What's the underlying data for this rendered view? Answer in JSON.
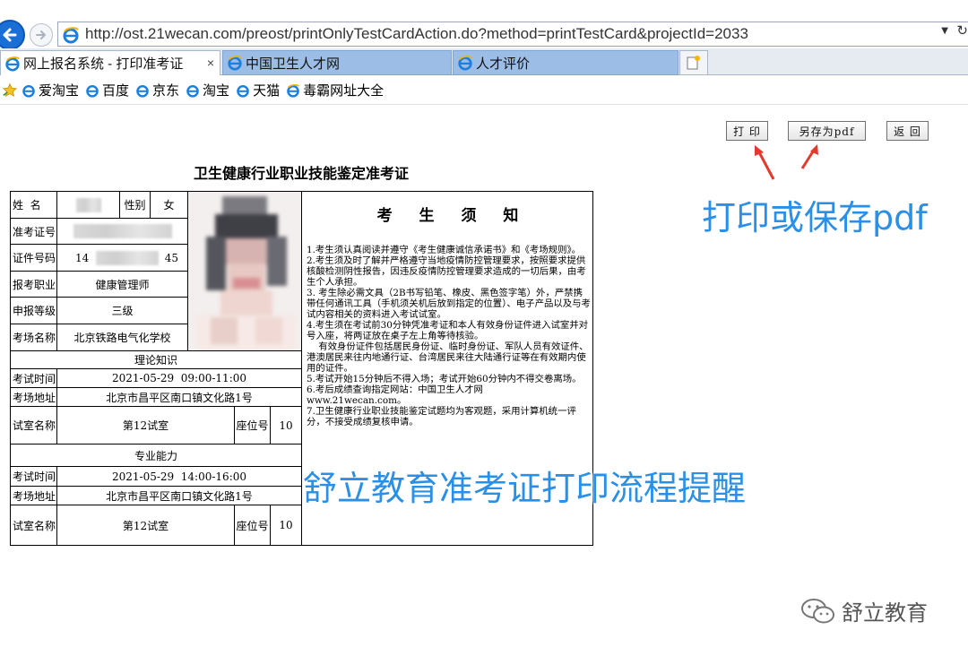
{
  "browser": {
    "url": "http://ost.21wecan.com/preost/printOnlyTestCardAction.do?method=printTestCard&projectId=2033",
    "tabs": [
      {
        "label": "网上报名系统 - 打印准考证",
        "close": "×"
      },
      {
        "label": "中国卫生人才网"
      },
      {
        "label": "人才评价"
      }
    ],
    "favorites": [
      "爱淘宝",
      "百度",
      "京东",
      "淘宝",
      "天猫",
      "毒霸网址大全"
    ]
  },
  "toolbar": {
    "print_label": "打 印",
    "savepdf_label": "另存为pdf",
    "back_label": "返 回"
  },
  "ticket": {
    "title": "卫生健康行业职业技能鉴定准考证",
    "labels": {
      "name": "姓  名",
      "gender": "性别",
      "exam_no": "准考证号",
      "id_no": "证件号码",
      "job": "报考职业",
      "level": "申报等级",
      "site": "考场名称",
      "theory": "理论知识",
      "time": "考试时间",
      "address": "考场地址",
      "room": "试室名称",
      "seat": "座位号",
      "skill": "专业能力"
    },
    "values": {
      "gender": "女",
      "id_prefix": "14",
      "id_suffix": "45",
      "job": "健康管理师",
      "level": "三级",
      "site": "北京铁路电气化学校",
      "theory_time": "2021-05-29  09:00-11:00",
      "theory_address": "北京市昌平区南口镇文化路1号",
      "theory_room": "第12试室",
      "theory_seat": "10",
      "skill_time": "2021-05-29  14:00-16:00",
      "skill_address": "北京市昌平区南口镇文化路1号",
      "skill_room": "第12试室",
      "skill_seat": "10"
    },
    "notice_title": "考 生 须 知",
    "notice": [
      "1.考生须认真阅读并遵守《考生健康诚信承诺书》和《考场规则》。",
      "2.考生须及时了解并严格遵守当地疫情防控管理要求，按照要求提供核酸检测阴性报告，因违反疫情防控管理要求造成的一切后果，由考生个人承担。",
      "3. 考生除必需文具（2B书写铅笔、橡皮、黑色签字笔）外，严禁携带任何通讯工具（手机须关机后放到指定的位置）、电子产品以及与考试内容相关的资料进入考试试室。",
      "4.考生须在考试前30分钟凭准考证和本人有效身份证件进入试室并对号入座，将两证放在桌子左上角等待核验。",
      "    有效身份证件包括居民身份证、临时身份证、军队人员有效证件、港澳居民来往内地通行证、台湾居民来往大陆通行证等在有效期内使用的证件。",
      "5.考试开始15分钟后不得入场；考试开始60分钟内不得交卷离场。",
      "6.考后成绩查询指定网站：中国卫生人才网",
      "www.21wecan.com。",
      "7.卫生健康行业职业技能鉴定试题均为客观题，采用计算机统一评分，不接受成绩复核申请。"
    ]
  },
  "annotations": {
    "print_hint": "打印或保存pdf",
    "reminder": "舒立教育准考证打印流程提醒",
    "watermark": "舒立教育"
  },
  "colors": {
    "annotation_blue": "#2a8fe6",
    "arrow_red": "#e23b2e",
    "tab_inactive": "#9bbde6"
  }
}
